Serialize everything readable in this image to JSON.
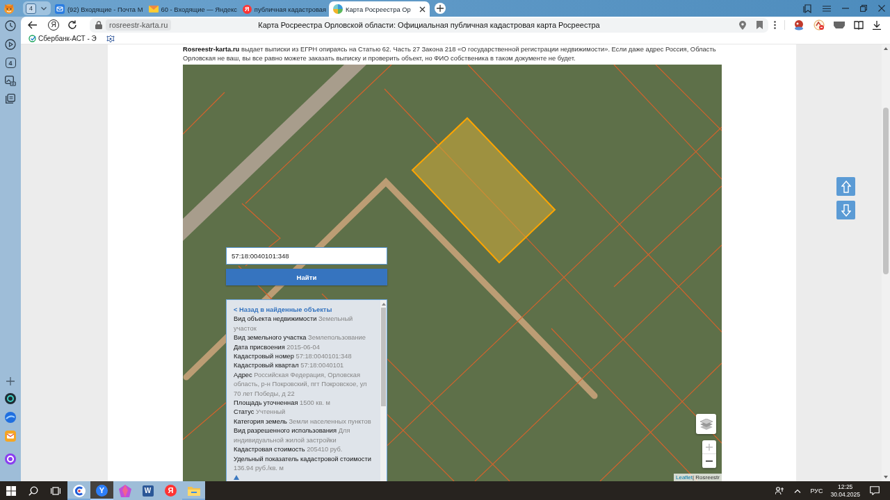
{
  "browser": {
    "tab_count": "4",
    "tabs": [
      {
        "kind": "mail",
        "title": "(92) Входящие - Почта М",
        "selected": false
      },
      {
        "kind": "envelope",
        "title": "60 - Входящие — Яндекс",
        "selected": false
      },
      {
        "kind": "yandex",
        "glyph": "Я",
        "title": "публичная кадастровая",
        "selected": false
      },
      {
        "kind": "site",
        "title": "Карта Росреестра Ор",
        "selected": true
      }
    ]
  },
  "sidebar": {
    "counter": "4"
  },
  "address_bar": {
    "home_glyph": "Я",
    "url": "rosreestr-karta.ru",
    "page_title": "Карта Росреестра Орловской области: Официальная публичная кадастровая карта Росреестра"
  },
  "bookmarks": [
    {
      "kind": "sber",
      "label": "Сбербанк-АСТ - Э"
    },
    {
      "kind": "emblem"
    }
  ],
  "page": {
    "intro": "**Rosreestr-karta.ru** выдает выписки из ЕГРН опираясь на Статью 62. Часть 27 Закона 218 «О государственной регистрации недвижимости». Если даже адрес Россия, Область Орловская не ваш, вы все равно можете заказать выписку и проверить объект, но ФИО собственика в таком документе не будет.",
    "search": {
      "value": "57:18:0040101:348",
      "button": "Найти"
    },
    "info_panel": {
      "back_link": "< Назад в найденные объекты",
      "properties": [
        {
          "term": "Вид объекта недвижимости",
          "definition": "Земельный участок"
        },
        {
          "term": "Вид земельного участка",
          "definition": "Землепользование"
        },
        {
          "term": "Дата присвоения",
          "definition": "2015-06-04"
        },
        {
          "term": "Кадастровый номер",
          "definition": "57:18:0040101:348"
        },
        {
          "term": "Кадастровый квартал",
          "definition": "57:18:0040101"
        },
        {
          "term": "Адрес",
          "definition": "Российская Федерация, Орловская область, р-н Покровский, пгт Покровское, ул 70 лет Победы, д 22"
        },
        {
          "term": "Площадь уточненная",
          "definition": "1500 кв. м"
        },
        {
          "term": "Статус",
          "definition": "Учтенный"
        },
        {
          "term": "Категория земель",
          "definition": "Земли населенных пунктов"
        },
        {
          "term": "Вид разрешенного использования",
          "definition": "Для индивидуальной жилой застройки"
        },
        {
          "term": "Кадастровая стоимость",
          "definition": "205410 руб."
        },
        {
          "term": "Удельный показатель кадастровой стоимости",
          "definition": "136.94 руб./кв. м"
        }
      ]
    },
    "attribution": {
      "link": "Leaflet",
      "text": "| Rosreestr"
    }
  },
  "taskbar": {
    "apps": [
      {
        "kind": "ring",
        "running": true,
        "selected": false
      },
      {
        "kind": "browser",
        "glyph": "Y",
        "running": true,
        "selected": true
      },
      {
        "kind": "gem",
        "running": false,
        "selected": false
      },
      {
        "kind": "word",
        "glyph": "W",
        "running": false,
        "selected": false
      },
      {
        "kind": "yandex",
        "glyph": "Я",
        "running": false,
        "selected": false
      },
      {
        "kind": "folder",
        "running": true,
        "selected": false
      }
    ],
    "language": "РУС",
    "time": "12:25",
    "date": "30.04.2025"
  }
}
